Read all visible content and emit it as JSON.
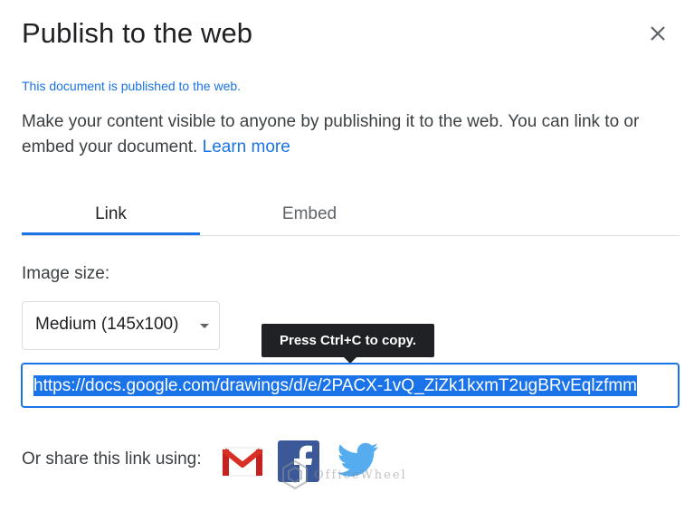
{
  "dialog": {
    "title": "Publish to the web",
    "close_icon": "close-icon",
    "status": "This document is published to the web.",
    "description": "Make your content visible to anyone by publishing it to the web. You can link to or embed your document.",
    "learn_more": "Learn more"
  },
  "tabs": [
    {
      "label": "Link",
      "active": true
    },
    {
      "label": "Embed",
      "active": false
    }
  ],
  "link_panel": {
    "image_size_label": "Image size:",
    "image_size_value": "Medium (145x100)",
    "tooltip": "Press Ctrl+C to copy.",
    "url": "https://docs.google.com/drawings/d/e/2PACX-1vQ_ZiZk1kxmT2ugBRvEqlzfmm"
  },
  "share": {
    "label": "Or share this link using:",
    "services": [
      "gmail-icon",
      "facebook-icon",
      "twitter-icon"
    ]
  },
  "watermark": {
    "text": "OfficeWheel"
  },
  "colors": {
    "accent": "#1a73e8",
    "tooltip_bg": "#202124",
    "text": "#202124",
    "muted": "#3c4043"
  }
}
